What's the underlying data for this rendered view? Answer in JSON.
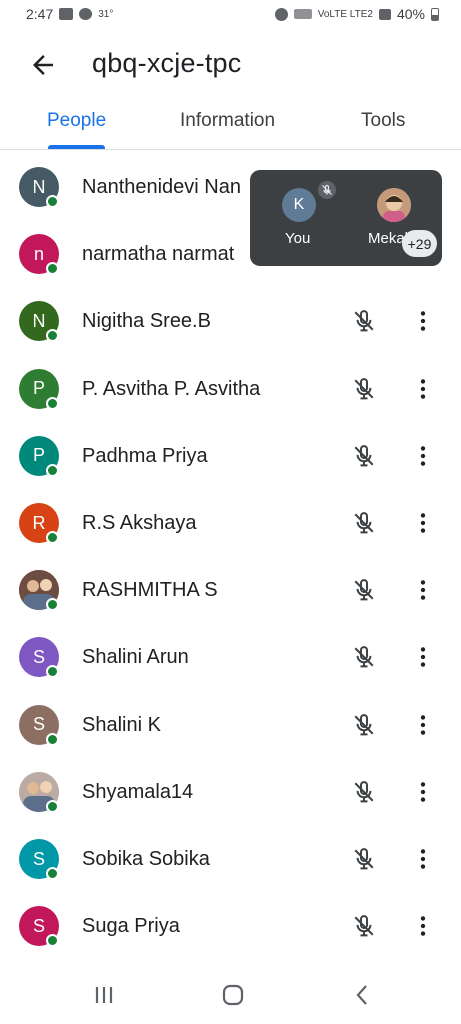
{
  "status_bar": {
    "time": "2:47",
    "temperature": "31°",
    "network": "VoLTE LTE2",
    "battery": "40%"
  },
  "header": {
    "back_icon": "arrow-back-icon",
    "title": "qbq-xcje-tpc"
  },
  "tabs": [
    {
      "label": "People",
      "active": true
    },
    {
      "label": "Information",
      "active": false
    },
    {
      "label": "Tools",
      "active": false
    }
  ],
  "participants": [
    {
      "initial": "N",
      "name": "Nanthenidevi Nan",
      "color": "#455a64",
      "photo": false
    },
    {
      "initial": "n",
      "name": "narmatha narmat",
      "color": "#c2185b",
      "photo": false
    },
    {
      "initial": "N",
      "name": "Nigitha Sree.B",
      "color": "#33691e",
      "photo": false
    },
    {
      "initial": "P",
      "name": "P. Asvitha P. Asvitha",
      "color": "#2e7d32",
      "photo": false
    },
    {
      "initial": "P",
      "name": "Padhma Priya",
      "color": "#00897b",
      "photo": false
    },
    {
      "initial": "R",
      "name": "R.S Akshaya",
      "color": "#d84315",
      "photo": false
    },
    {
      "initial": "",
      "name": "RASHMITHA S",
      "color": "#6d4c41",
      "photo": true
    },
    {
      "initial": "S",
      "name": "Shalini Arun",
      "color": "#7e57c2",
      "photo": false
    },
    {
      "initial": "S",
      "name": "Shalini K",
      "color": "#8d6e63",
      "photo": false
    },
    {
      "initial": "",
      "name": "Shyamala14",
      "color": "#bcaaa4",
      "photo": true
    },
    {
      "initial": "S",
      "name": "Sobika Sobika",
      "color": "#0097a7",
      "photo": false
    },
    {
      "initial": "S",
      "name": "Suga Priya",
      "color": "#c2185b",
      "photo": false
    }
  ],
  "overlay": {
    "self_initial": "K",
    "self_label": "You",
    "other_label": "Mekal",
    "more_count": "+29"
  },
  "colors": {
    "accent": "#1a73e8",
    "presence": "#188038",
    "overlay_bg": "#3c4043"
  }
}
